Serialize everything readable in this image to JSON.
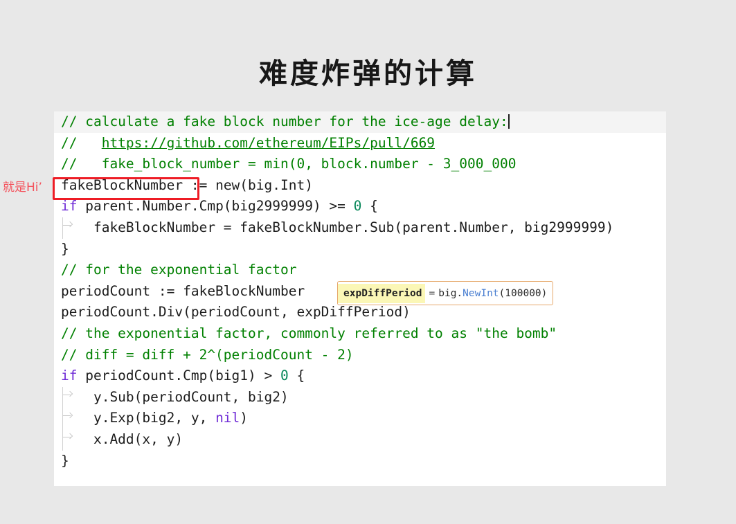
{
  "slide": {
    "title": "难度炸弹的计算"
  },
  "annotation": {
    "text": "就是Hi’",
    "color": "#f4525c",
    "boxed_token": "fakeBlockNumber",
    "box_color": "#ee1c25"
  },
  "tooltip": {
    "symbol": "expDiffPeriod",
    "equals": "=",
    "package": "big.",
    "function": "NewInt",
    "arguments": "(100000)",
    "highlight_color": "#fbf7b6",
    "border_color": "#e6a86a"
  },
  "editor": {
    "language": "go",
    "comment_color": "#008000",
    "keyword_color": "#6f2bd6",
    "number_color": "#09885a",
    "text_color": "#1c1c1c",
    "background": "#ffffff",
    "current_line_background": "#f4f4f4",
    "lines": [
      {
        "current": true,
        "guide": false,
        "tokens": [
          {
            "t": "// calculate a fake block number for the ice-age delay:",
            "c": "cm"
          },
          {
            "t": "",
            "c": "caret"
          }
        ]
      },
      {
        "current": false,
        "guide": false,
        "tokens": [
          {
            "t": "//   ",
            "c": "cm"
          },
          {
            "t": "https://github.com/ethereum/EIPs/pull/669",
            "c": "cm-link"
          }
        ]
      },
      {
        "current": false,
        "guide": false,
        "tokens": [
          {
            "t": "//   fake_block_number = min(0, block.number - 3_000_000",
            "c": "cm"
          }
        ]
      },
      {
        "current": false,
        "guide": false,
        "tokens": [
          {
            "t": "fakeBlockNumber",
            "c": "id"
          },
          {
            "t": " := ",
            "c": "id"
          },
          {
            "t": "new(big.Int)",
            "c": "id"
          }
        ]
      },
      {
        "current": false,
        "guide": false,
        "tokens": [
          {
            "t": "if",
            "c": "kw"
          },
          {
            "t": " parent.Number.Cmp(big2999999) >= ",
            "c": "id"
          },
          {
            "t": "0",
            "c": "num"
          },
          {
            "t": " {",
            "c": "brk"
          }
        ]
      },
      {
        "current": false,
        "guide": true,
        "tokens": [
          {
            "t": "    fakeBlockNumber = fakeBlockNumber.Sub(parent.Number, big2999999)",
            "c": "id"
          }
        ]
      },
      {
        "current": false,
        "guide": false,
        "tokens": [
          {
            "t": "}",
            "c": "brk"
          }
        ]
      },
      {
        "current": false,
        "guide": false,
        "tokens": [
          {
            "t": "// for the exponential factor",
            "c": "cm"
          }
        ]
      },
      {
        "current": false,
        "guide": false,
        "tokens": [
          {
            "t": "periodCount := fakeBlockNumber",
            "c": "id"
          }
        ]
      },
      {
        "current": false,
        "guide": false,
        "tokens": [
          {
            "t": "periodCount.Div(periodCount, expDiffPeriod)",
            "c": "id"
          }
        ]
      },
      {
        "current": false,
        "guide": false,
        "tokens": [
          {
            "t": "// the exponential factor, commonly referred to as \"the bomb\"",
            "c": "cm"
          }
        ]
      },
      {
        "current": false,
        "guide": false,
        "tokens": [
          {
            "t": "// diff = diff + 2^(periodCount - 2)",
            "c": "cm"
          }
        ]
      },
      {
        "current": false,
        "guide": false,
        "tokens": [
          {
            "t": "if",
            "c": "kw"
          },
          {
            "t": " periodCount.Cmp(big1) > ",
            "c": "id"
          },
          {
            "t": "0",
            "c": "num"
          },
          {
            "t": " {",
            "c": "brk"
          }
        ]
      },
      {
        "current": false,
        "guide": true,
        "tokens": [
          {
            "t": "    y.Sub(periodCount, big2)",
            "c": "id"
          }
        ]
      },
      {
        "current": false,
        "guide": true,
        "tokens": [
          {
            "t": "    y.Exp(big2, y, ",
            "c": "id"
          },
          {
            "t": "nil",
            "c": "kw"
          },
          {
            "t": ")",
            "c": "brk"
          }
        ]
      },
      {
        "current": false,
        "guide": true,
        "tokens": [
          {
            "t": "    x.Add(x, y)",
            "c": "id"
          }
        ]
      },
      {
        "current": false,
        "guide": false,
        "tokens": [
          {
            "t": "}",
            "c": "brk"
          }
        ]
      }
    ]
  }
}
